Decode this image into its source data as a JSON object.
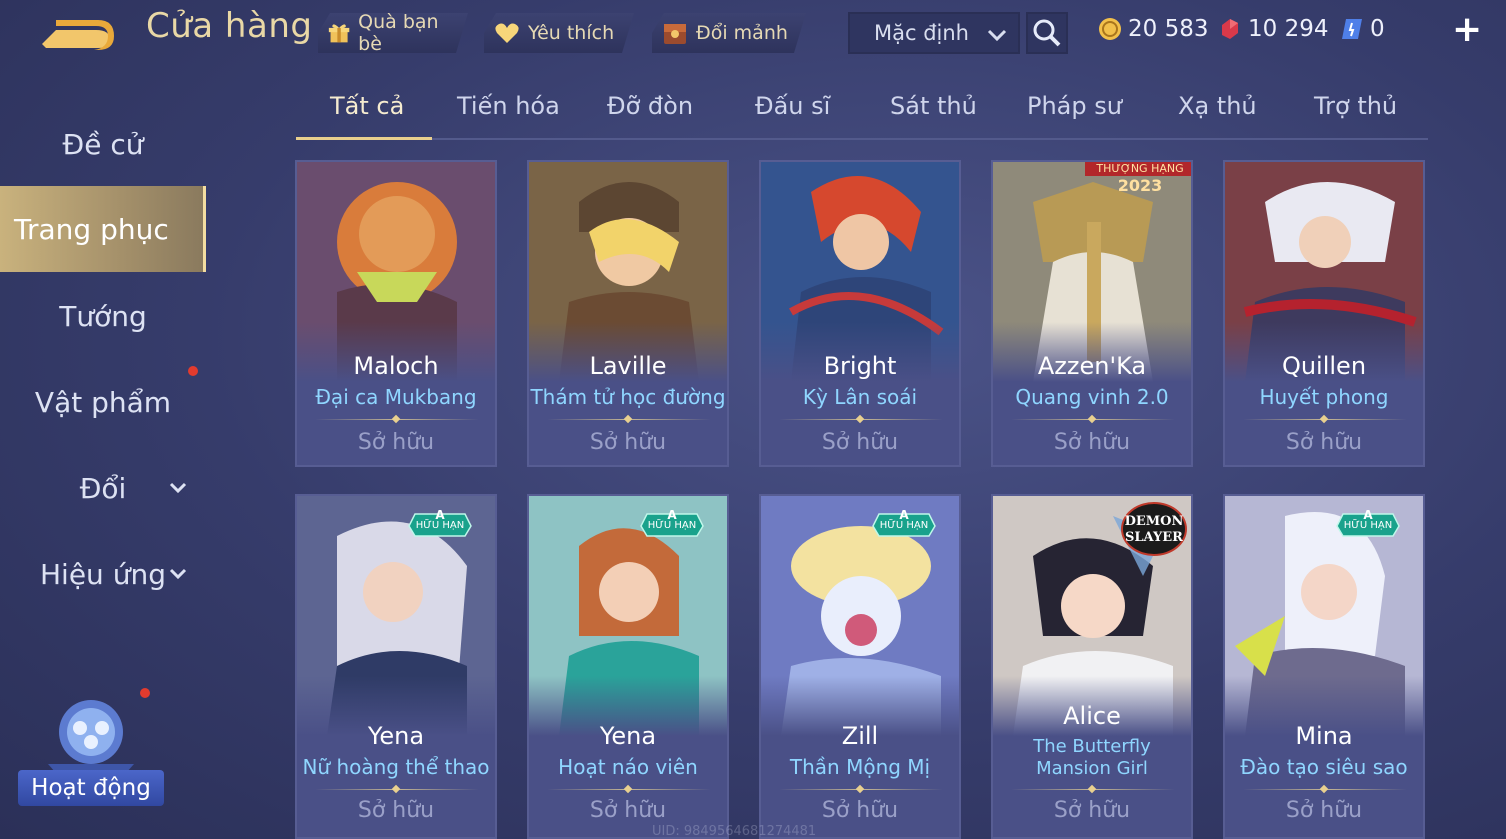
{
  "header": {
    "title": "Cửa hàng",
    "chips": [
      {
        "label": "Quà bạn bè",
        "icon": "gift-icon"
      },
      {
        "label": "Yêu thích",
        "icon": "heart-icon"
      },
      {
        "label": "Đổi mảnh",
        "icon": "chest-icon"
      }
    ],
    "sort": {
      "selected": "Mặc định"
    },
    "currencies": [
      {
        "icon": "gold-coin-icon",
        "value": "20 583"
      },
      {
        "icon": "red-gem-icon",
        "value": "10 294"
      },
      {
        "icon": "blue-voucher-icon",
        "value": "0"
      }
    ],
    "plus": "+"
  },
  "sidebar": {
    "items": [
      {
        "label": "Đề cử"
      },
      {
        "label": "Trang phục"
      },
      {
        "label": "Tướng"
      },
      {
        "label": "Vật phẩm"
      },
      {
        "label": "Đổi"
      },
      {
        "label": "Hiệu ứng"
      }
    ],
    "activity": "Hoạt động"
  },
  "tabs": [
    "Tất cả",
    "Tiến hóa",
    "Đỡ đòn",
    "Đấu sĩ",
    "Sát thủ",
    "Pháp sư",
    "Xạ thủ",
    "Trợ thủ"
  ],
  "cards": [
    {
      "hero": "Maloch",
      "skin": "Đại ca Mukbang",
      "status": "Sở hữu"
    },
    {
      "hero": "Laville",
      "skin": "Thám tử học đường",
      "status": "Sở hữu"
    },
    {
      "hero": "Bright",
      "skin": "Kỳ Lân soái",
      "status": "Sở hữu"
    },
    {
      "hero": "Azzen'Ka",
      "skin": "Quang vinh 2.0",
      "status": "Sở hữu",
      "badge1": "THƯỢNG HẠNG",
      "badge2": "2023"
    },
    {
      "hero": "Quillen",
      "skin": "Huyết phong",
      "status": "Sở hữu"
    },
    {
      "hero": "Yena",
      "skin": "Nữ hoàng thể thao",
      "status": "Sở hữu",
      "badge_a": "A",
      "badge_text": "HỮU HẠN"
    },
    {
      "hero": "Yena",
      "skin": "Hoạt náo viên",
      "status": "Sở hữu",
      "badge_a": "A",
      "badge_text": "HỮU HẠN"
    },
    {
      "hero": "Zill",
      "skin": "Thần Mộng Mị",
      "status": "Sở hữu",
      "badge_a": "A",
      "badge_text": "HỮU HẠN"
    },
    {
      "hero": "Alice",
      "skin": "The Butterfly Mansion Girl",
      "status": "Sở hữu",
      "demon1": "DEMON",
      "demon2": "SLAYER"
    },
    {
      "hero": "Mina",
      "skin": "Đào tạo siêu sao",
      "status": "Sở hữu",
      "badge_a": "A",
      "badge_text": "HỮU HẠN"
    }
  ],
  "uid": "UID: 9849564681274481"
}
